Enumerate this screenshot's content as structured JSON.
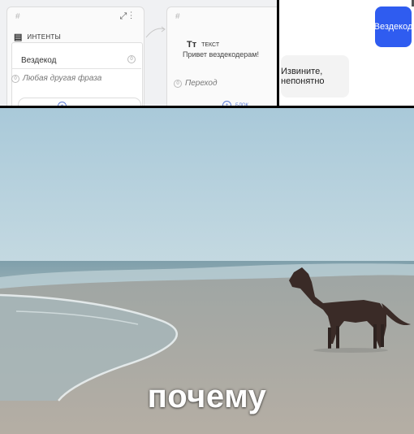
{
  "builder": {
    "intent_block": {
      "hash": "#",
      "heading": "ИНТЕНТЫ",
      "phrase": "Вездекод",
      "other_phrase": "Любая другая фраза"
    },
    "text_block": {
      "hash": "#",
      "heading": "ТЕКСТ",
      "body": "Привет вездекодерам!",
      "goto": "Переход",
      "add_label": "БЛОК"
    }
  },
  "chat": {
    "user_message": "Вездекод",
    "bot_reply": "Извините, непонятно"
  },
  "meme": {
    "caption": "почему"
  },
  "colors": {
    "chat_user_bubble": "#2f5cf0",
    "chat_bot_bubble": "#f3f3f3",
    "canvas_bg": "#f0f1f3",
    "accent": "#5b7bd6"
  }
}
